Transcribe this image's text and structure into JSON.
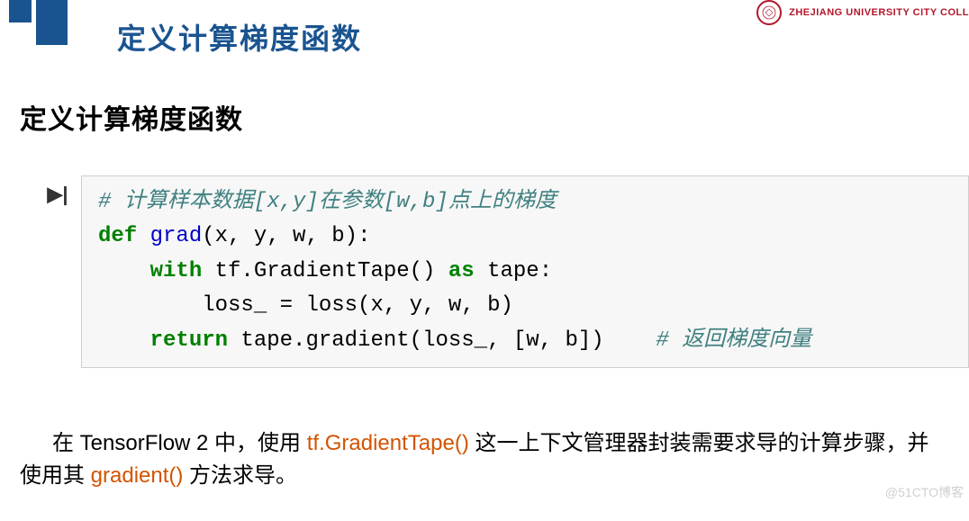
{
  "header": {
    "title": "定义计算梯度函数",
    "university_text": "ZHEJIANG UNIVERSITY CITY COLL"
  },
  "subtitle": "定义计算梯度函数",
  "code": {
    "comment1": "# 计算样本数据[x,y]在参数[w,b]点上的梯度",
    "def_kw": "def",
    "func_name": "grad",
    "def_sig": "(x, y, w, b):",
    "with_kw": "with",
    "with_body1": " tf.GradientTape() ",
    "as_kw": "as",
    "with_body2": " tape:",
    "loss_line": "        loss_ = loss(x, y, w, b)",
    "return_kw": "return",
    "return_body": " tape.gradient(loss_, [w, b])    ",
    "comment2": "# 返回梯度向量"
  },
  "paragraph": {
    "pre1": "在 TensorFlow 2 中，使用 ",
    "hl1": "tf.GradientTape()",
    "mid1": " 这一上下文管理器封装需要求导的计算步骤，并使用其 ",
    "hl2": "gradient()",
    "post1": " 方法求导。"
  },
  "watermark": "@51CTO博客"
}
